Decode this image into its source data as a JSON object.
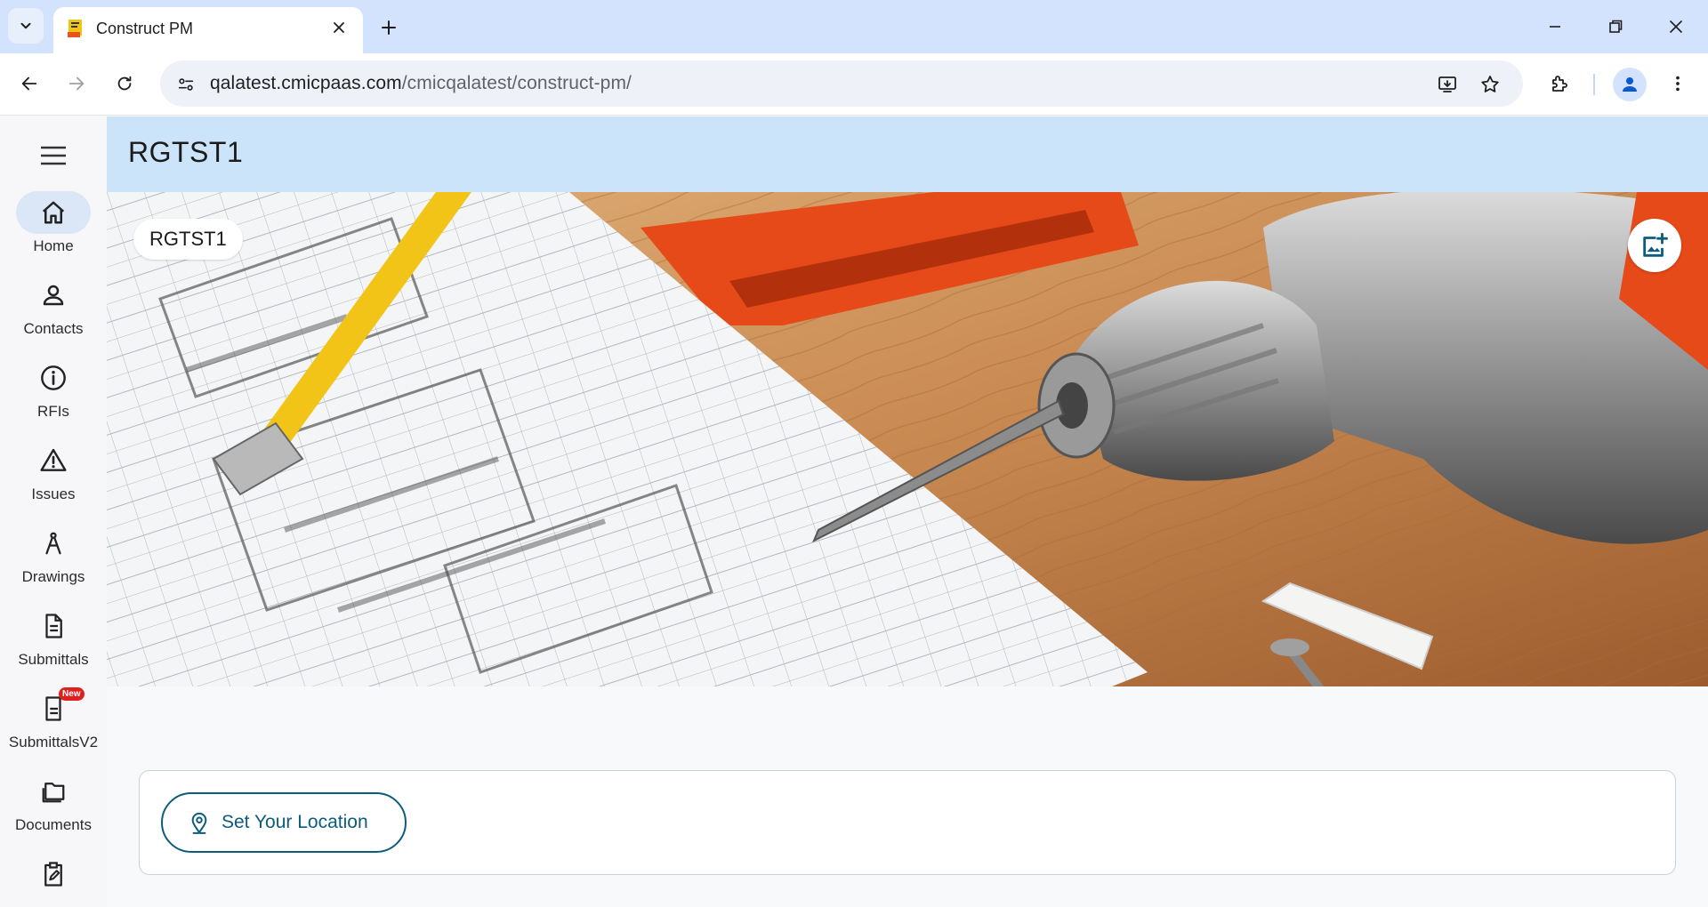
{
  "browser": {
    "tab_title": "Construct PM",
    "url_host": "qalatest.cmicpaas.com",
    "url_path": "/cmicqalatest/construct-pm/"
  },
  "sidebar": {
    "items": [
      {
        "label": "Home",
        "icon": "home-icon",
        "active": true
      },
      {
        "label": "Contacts",
        "icon": "person-icon"
      },
      {
        "label": "RFIs",
        "icon": "info-icon"
      },
      {
        "label": "Issues",
        "icon": "warning-icon"
      },
      {
        "label": "Drawings",
        "icon": "compass-icon"
      },
      {
        "label": "Submittals",
        "icon": "document-icon"
      },
      {
        "label": "SubmittalsV2",
        "icon": "document-new-icon",
        "badge": "New"
      },
      {
        "label": "Documents",
        "icon": "folder-icon"
      },
      {
        "label": "",
        "icon": "clipboard-edit-icon"
      }
    ]
  },
  "header": {
    "title": "RGTST1"
  },
  "hero": {
    "chip_label": "RGTST1"
  },
  "location": {
    "button_label": "Set Your Location"
  },
  "colors": {
    "accent": "#0d5c7e",
    "header_bg": "#cce4fa",
    "active_nav": "#dbe6f7"
  }
}
